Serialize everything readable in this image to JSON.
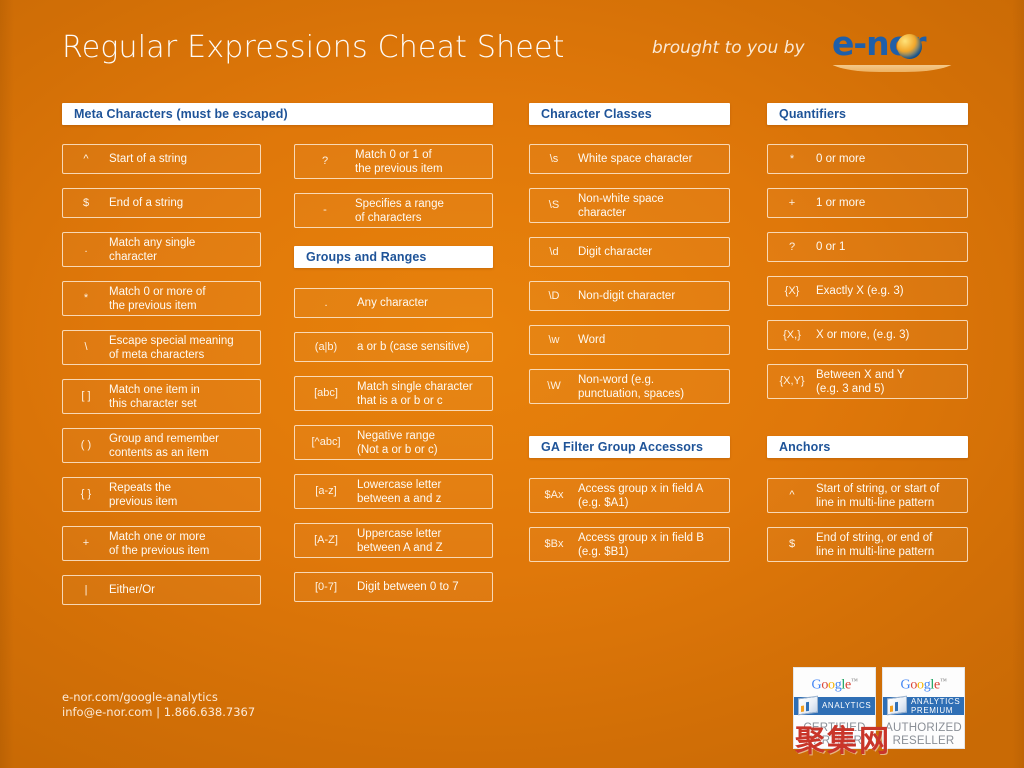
{
  "header": {
    "title": "Regular Expressions Cheat Sheet",
    "brought_by": "brought to you by",
    "logo_text": "e-nor"
  },
  "sections": {
    "meta": {
      "title": "Meta Characters (must be escaped)",
      "items": [
        {
          "symbol": "^",
          "desc": "Start of a string"
        },
        {
          "symbol": "$",
          "desc": "End of a string"
        },
        {
          "symbol": ".",
          "desc": "Match any single\ncharacter"
        },
        {
          "symbol": "*",
          "desc": "Match 0 or more of\nthe previous item"
        },
        {
          "symbol": "\\",
          "desc": "Escape special meaning\nof meta characters"
        },
        {
          "symbol": "[ ]",
          "desc": "Match one item in\nthis character set"
        },
        {
          "symbol": "( )",
          "desc": "Group and remember\ncontents as an item"
        },
        {
          "symbol": "{ }",
          "desc": "Repeats the\nprevious item"
        },
        {
          "symbol": "+",
          "desc": "Match one or more\nof the previous item"
        },
        {
          "symbol": "|",
          "desc": "Either/Or"
        }
      ]
    },
    "meta_right": {
      "items": [
        {
          "symbol": "?",
          "desc": "Match 0 or 1 of\nthe previous item"
        },
        {
          "symbol": "-",
          "desc": "Specifies a range\nof characters"
        }
      ]
    },
    "groups": {
      "title": "Groups and Ranges",
      "items": [
        {
          "symbol": ".",
          "desc": "Any character"
        },
        {
          "symbol": "(a|b)",
          "desc": "a or b (case sensitive)"
        },
        {
          "symbol": "[abc]",
          "desc": "Match single character\nthat is a or b or c"
        },
        {
          "symbol": "[^abc]",
          "desc": "Negative range\n(Not a or b or c)"
        },
        {
          "symbol": "[a-z]",
          "desc": "Lowercase letter\nbetween a and z"
        },
        {
          "symbol": "[A-Z]",
          "desc": "Uppercase letter\nbetween A and Z"
        },
        {
          "symbol": "[0-7]",
          "desc": "Digit between 0 to 7"
        }
      ]
    },
    "classes": {
      "title": "Character Classes",
      "items": [
        {
          "symbol": "\\s",
          "desc": "White space character"
        },
        {
          "symbol": "\\S",
          "desc": "Non-white space\ncharacter"
        },
        {
          "symbol": "\\d",
          "desc": "Digit character"
        },
        {
          "symbol": "\\D",
          "desc": "Non-digit character"
        },
        {
          "symbol": "\\w",
          "desc": "Word"
        },
        {
          "symbol": "\\W",
          "desc": "Non-word (e.g.\npunctuation, spaces)"
        }
      ]
    },
    "ga_filter": {
      "title": "GA Filter Group Accessors",
      "items": [
        {
          "symbol": "$Ax",
          "desc": "Access group x in field A\n(e.g. $A1)"
        },
        {
          "symbol": "$Bx",
          "desc": "Access group x in field B\n(e.g. $B1)"
        }
      ]
    },
    "quantifiers": {
      "title": "Quantifiers",
      "items": [
        {
          "symbol": "*",
          "desc": "0 or more"
        },
        {
          "symbol": "+",
          "desc": "1 or more"
        },
        {
          "symbol": "?",
          "desc": "0 or 1"
        },
        {
          "symbol": "{X}",
          "desc": "Exactly X (e.g. 3)"
        },
        {
          "symbol": "{X,}",
          "desc": "X or more, (e.g. 3)"
        },
        {
          "symbol": "{X,Y}",
          "desc": "Between X and Y\n(e.g. 3 and 5)"
        }
      ]
    },
    "anchors": {
      "title": "Anchors",
      "items": [
        {
          "symbol": "^",
          "desc": "Start of string, or start of\nline in multi-line pattern"
        },
        {
          "symbol": "$",
          "desc": "End of string, or end of\nline in multi-line pattern"
        }
      ]
    }
  },
  "footer": {
    "line1": "e-nor.com/google-analytics",
    "line2": "info@e-nor.com | 1.866.638.7367",
    "watermark": "聚集网",
    "badges": [
      {
        "brand": "Google",
        "program": "ANALYTICS",
        "main": "CERTIFIED\nPARTNER"
      },
      {
        "brand": "Google",
        "program": "ANALYTICS\nPREMIUM",
        "main": "AUTHORIZED\nRESELLER"
      }
    ]
  },
  "colors": {
    "background": "#e0780a",
    "header_text": "#1e5398",
    "card_text": "#fdf4e9",
    "logo_blue": "#1f5fa9"
  }
}
